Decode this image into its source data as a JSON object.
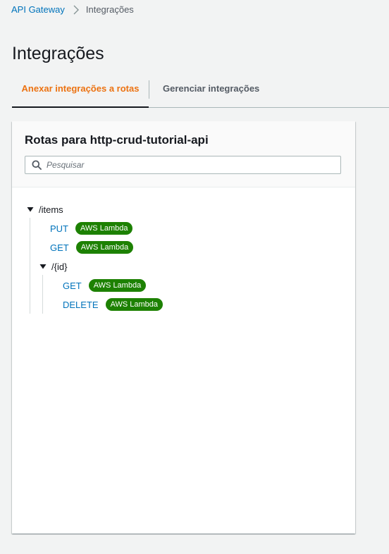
{
  "breadcrumb": {
    "parent": "API Gateway",
    "current": "Integrações",
    "separator_icon": "chevron-right-icon"
  },
  "page": {
    "title": "Integrações"
  },
  "tabs": [
    {
      "label": "Anexar integrações a rotas",
      "active": true
    },
    {
      "label": "Gerenciar integrações",
      "active": false
    }
  ],
  "panel": {
    "title": "Rotas para http-crud-tutorial-api",
    "search": {
      "placeholder": "Pesquisar",
      "value": "",
      "icon": "search-icon"
    }
  },
  "routes": {
    "items": {
      "path": "/items",
      "expanded": true,
      "methods": [
        {
          "method": "PUT",
          "integration": "AWS Lambda"
        },
        {
          "method": "GET",
          "integration": "AWS Lambda"
        }
      ],
      "children": {
        "id": {
          "path": "/{id}",
          "expanded": true,
          "methods": [
            {
              "method": "GET",
              "integration": "AWS Lambda"
            },
            {
              "method": "DELETE",
              "integration": "AWS Lambda"
            }
          ]
        }
      }
    }
  },
  "colors": {
    "link": "#0073bb",
    "active_tab": "#ec7211",
    "badge": "#1d8102",
    "background": "#f2f3f3"
  }
}
